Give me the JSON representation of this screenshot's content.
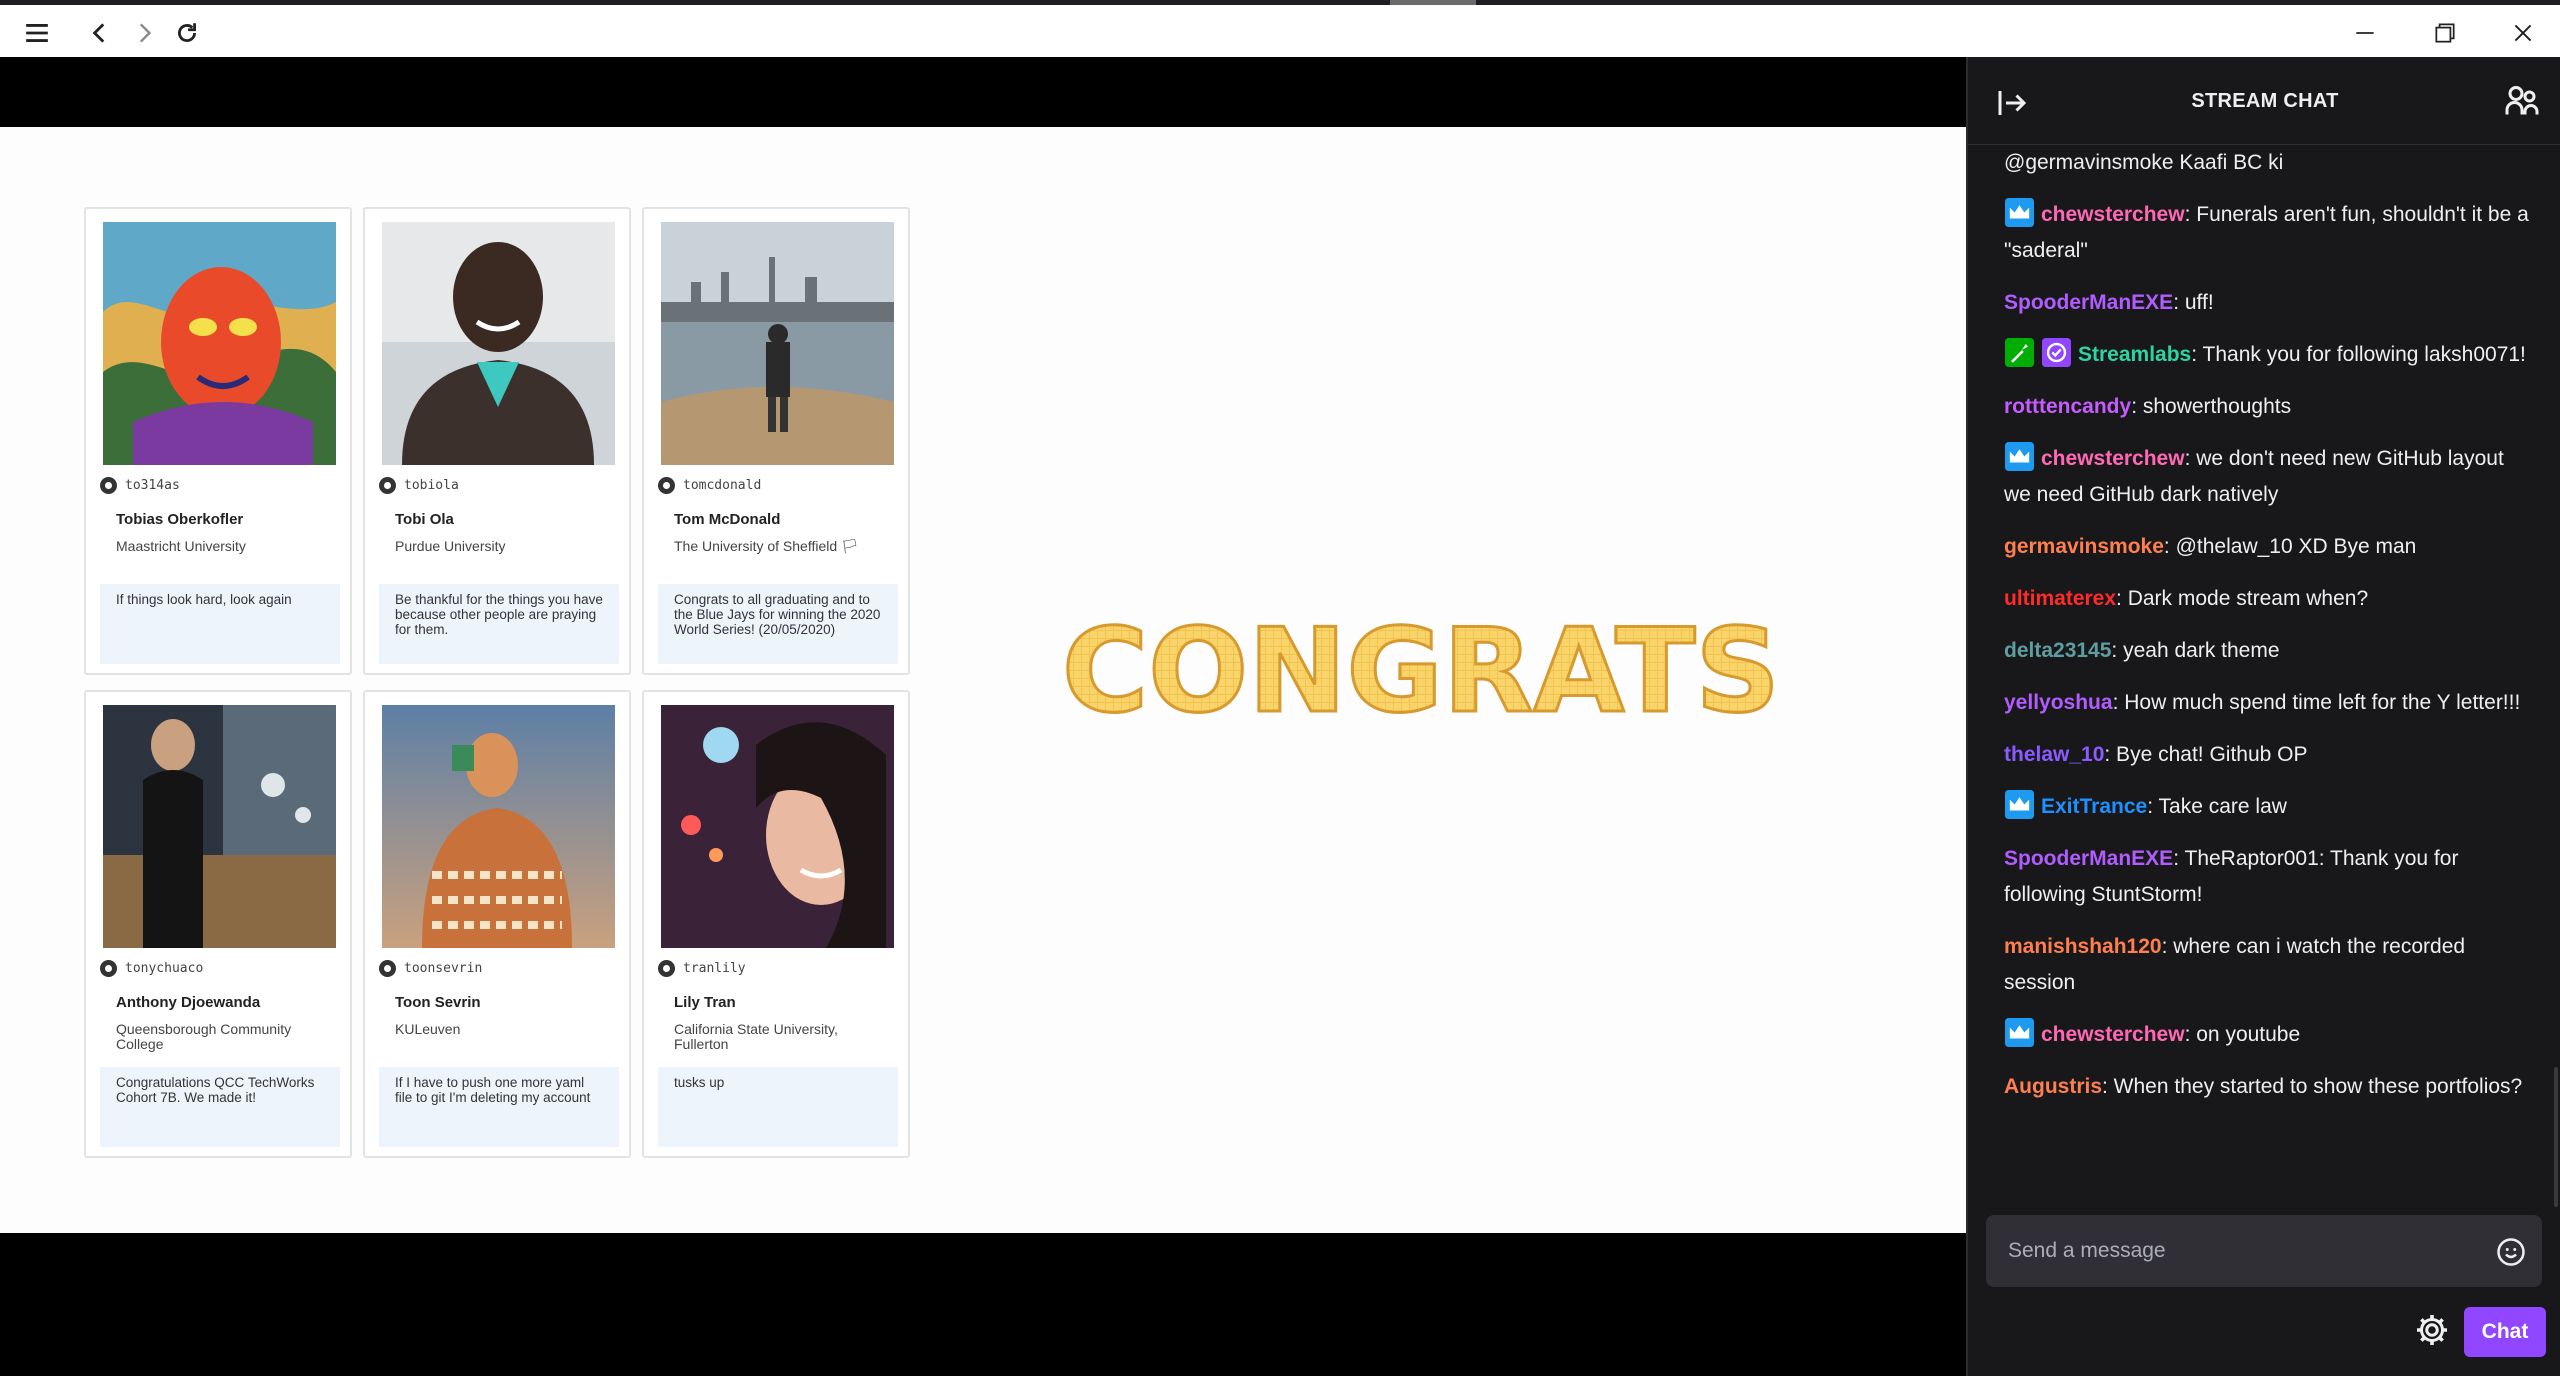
{
  "window": {
    "menu_icon": "hamburger-icon",
    "back_icon": "chevron-left-icon",
    "forward_icon": "chevron-right-icon",
    "reload_icon": "reload-icon",
    "minimize_icon": "minimize-icon",
    "restore_icon": "restore-icon",
    "close_icon": "close-icon"
  },
  "slide": {
    "banner_text": "CONGRATS",
    "cards": [
      {
        "handle": "to314as",
        "name": "Tobias Oberkofler",
        "school": "Maastricht University",
        "quote": "If things look hard, look again"
      },
      {
        "handle": "tobiola",
        "name": "Tobi Ola",
        "school": "Purdue University",
        "quote": "Be thankful for the things you have because other people are praying for them."
      },
      {
        "handle": "tomcdonald",
        "name": "Tom McDonald",
        "school": "The University of Sheffield 🏳",
        "quote": "Congrats to all graduating and to the Blue Jays for winning the 2020 World Series! (20/05/2020)"
      },
      {
        "handle": "tonychuaco",
        "name": "Anthony Djoewanda",
        "school": "Queensborough Community College",
        "quote": "Congratulations QCC TechWorks Cohort 7B. We made it!"
      },
      {
        "handle": "toonsevrin",
        "name": "Toon Sevrin",
        "school": "KULeuven",
        "quote": "If I have to push one more yaml file to git I'm deleting my account"
      },
      {
        "handle": "tranlily",
        "name": "Lily Tran",
        "school": "California State University, Fullerton",
        "quote": "tusks up"
      }
    ]
  },
  "chat": {
    "title": "STREAM CHAT",
    "input_placeholder": "Send a message",
    "send_label": "Chat",
    "colors": {
      "purple": "#9147ff",
      "bg": "#18181b"
    },
    "messages": [
      {
        "user": "",
        "color": "#efeff1",
        "text": "@germavinsmoke Kaafi BC ki",
        "badges": []
      },
      {
        "user": "chewsterchew",
        "color": "#ff69b4",
        "text": ": Funerals aren't fun, shouldn't it be a \"saderal\"",
        "badges": [
          "prime"
        ]
      },
      {
        "user": "SpooderManEXE",
        "color": "#b15cff",
        "text": ": uff!",
        "badges": []
      },
      {
        "user": "Streamlabs",
        "color": "#2dd4a0",
        "text": ": Thank you for following laksh0071!",
        "badges": [
          "moderator",
          "verified"
        ]
      },
      {
        "user": "rotttencandy",
        "color": "#c65cff",
        "text": ": showerthoughts",
        "badges": []
      },
      {
        "user": "chewsterchew",
        "color": "#ff69b4",
        "text": ": we don't need new GitHub layout we need GitHub dark natively",
        "badges": [
          "prime"
        ]
      },
      {
        "user": "germavinsmoke",
        "color": "#ff7f50",
        "text": ": @thelaw_10 XD Bye man",
        "badges": []
      },
      {
        "user": "ultimaterex",
        "color": "#ff2a2a",
        "text": ": Dark mode stream when?",
        "badges": []
      },
      {
        "user": "delta23145",
        "color": "#5f9ea0",
        "text": ": yeah dark theme",
        "badges": []
      },
      {
        "user": "yellyoshua",
        "color": "#b15cff",
        "text": ": How much spend time left for the Y letter!!!",
        "badges": []
      },
      {
        "user": "thelaw_10",
        "color": "#8a5cff",
        "text": ": Bye chat! Github OP",
        "badges": []
      },
      {
        "user": "ExitTrance",
        "color": "#1e90ff",
        "text": ": Take care law",
        "badges": [
          "prime"
        ]
      },
      {
        "user": "SpooderManEXE",
        "color": "#b15cff",
        "text": ": TheRaptor001: Thank you for following StuntStorm!",
        "badges": []
      },
      {
        "user": "manishshah120",
        "color": "#ff7f50",
        "text": ": where can i watch the recorded session",
        "badges": []
      },
      {
        "user": "chewsterchew",
        "color": "#ff69b4",
        "text": ": on youtube",
        "badges": [
          "prime"
        ]
      },
      {
        "user": "Augustris",
        "color": "#ff7f50",
        "text": ": When they started to show these portfolios?",
        "badges": []
      }
    ]
  }
}
